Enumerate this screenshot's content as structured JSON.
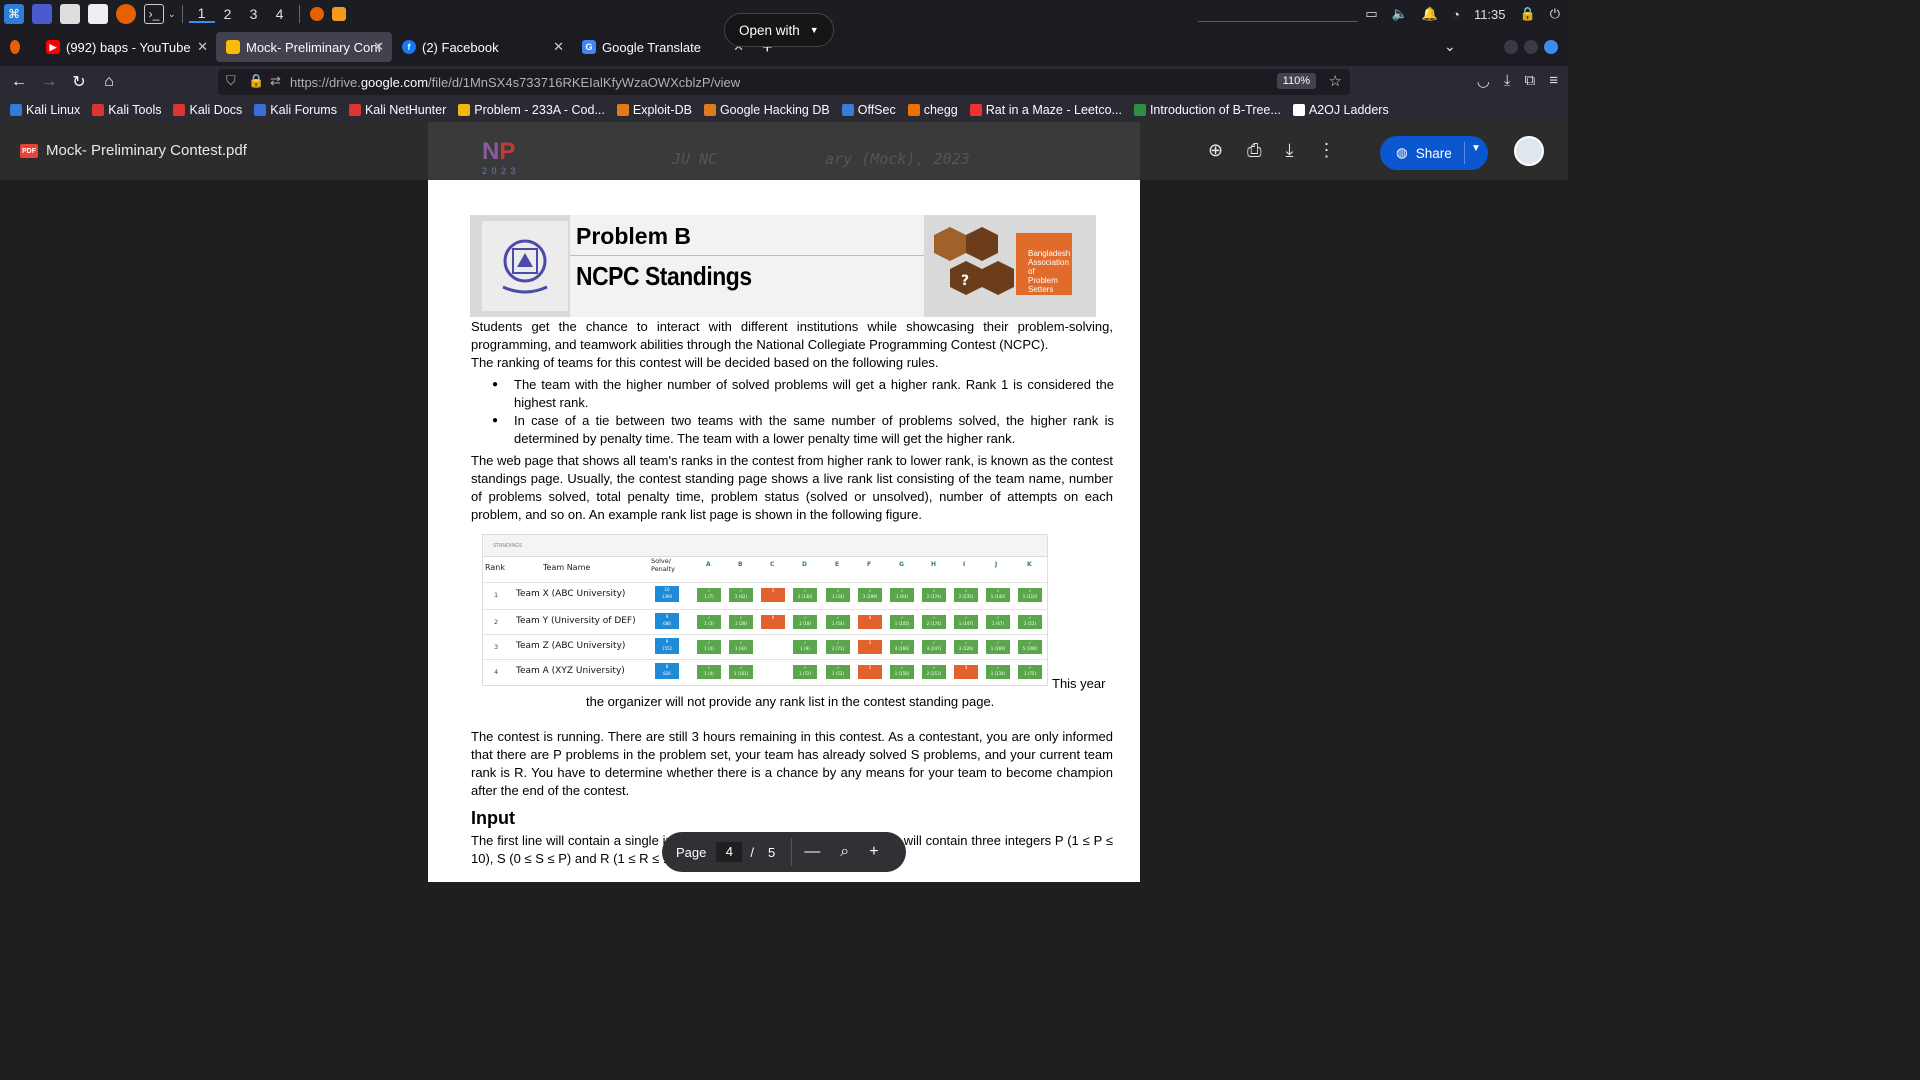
{
  "taskbar": {
    "workspaces": [
      "1",
      "2",
      "3",
      "4"
    ],
    "clock": "11:35"
  },
  "tabs": [
    {
      "label": "(992) baps - YouTube",
      "color": "#ff0000"
    },
    {
      "label": "Mock- Preliminary Conte",
      "color": "#fbbc04"
    },
    {
      "label": "(2) Facebook",
      "color": "#1877f2"
    },
    {
      "label": "Google Translate",
      "color": "#4285f4"
    }
  ],
  "nav": {
    "url_prefix": "https://drive.",
    "url_domain": "google.com",
    "url_rest": "/file/d/1MnSX4s733716RKEIalKfyWzaOWXcblzP/view",
    "zoom": "110%"
  },
  "bookmarks": [
    {
      "label": "Kali Linux",
      "color": "#2e7dd7"
    },
    {
      "label": "Kali Tools",
      "color": "#d33"
    },
    {
      "label": "Kali Docs",
      "color": "#d33"
    },
    {
      "label": "Kali Forums",
      "color": "#3b6fd8"
    },
    {
      "label": "Kali NetHunter",
      "color": "#d33"
    },
    {
      "label": "Problem - 233A - Cod...",
      "color": "#f2b705"
    },
    {
      "label": "Exploit-DB",
      "color": "#e07a1f"
    },
    {
      "label": "Google Hacking DB",
      "color": "#e07a1f"
    },
    {
      "label": "OffSec",
      "color": "#3a7bd5"
    },
    {
      "label": "chegg",
      "color": "#eb7100"
    },
    {
      "label": "Rat in a Maze - Leetco...",
      "color": "#e33"
    },
    {
      "label": "Introduction of B-Tree...",
      "color": "#2f8d46"
    },
    {
      "label": "A2OJ Ladders",
      "color": "#ffffff"
    }
  ],
  "drive": {
    "pdf_badge": "PDF",
    "filename": "Mock- Preliminary Contest.pdf",
    "open_with": "Open with",
    "share": "Share"
  },
  "page_header": {
    "title_left": "JU NC",
    "title_right": "ary (Mock), 2023",
    "logo_year": "2 0 2 3"
  },
  "problem": {
    "letter": "Problem B",
    "name": "NCPC Standings",
    "bap": [
      "Bangladesh",
      "Association",
      "of",
      "Problem",
      "Setters"
    ],
    "p1": "Students get the chance to interact with different institutions while showcasing their problem-solving, programming, and teamwork abilities through the National Collegiate Programming Contest (NCPC).",
    "p2": "The ranking of teams for this contest will be decided based on the following rules.",
    "b1": "The team with the higher number of solved problems will get a higher rank. Rank 1 is considered the highest rank.",
    "b2": "In case of a tie between two teams with the same number of problems solved, the higher rank is determined by penalty time. The team with a lower penalty time will get the higher rank.",
    "p3": "The web page that shows all team's ranks in the contest from higher rank to lower rank, is known as the contest standings page. Usually, the contest standing page shows a live rank list consisting of the team name, number of problems solved, total penalty time, problem status (solved or unsolved), number of attempts on each problem, and so on. An example rank list page is shown in the following figure.",
    "p4a": "This year",
    "p4b": "the organizer will not provide any rank list in the contest standing page.",
    "p5": "The contest is running. There are still 3 hours remaining in this contest. As a contestant, you are only informed that  there are P problems in the problem set, your team has already solved S problems, and your current team rank is R. You have to determine whether there is a chance by any means for your team to become champion after the end of the contest.",
    "input_heading": "Input",
    "p6": "The first line will contain a single integer T (1 ≤ T ≤ 18150). Each test case will contain three integers P (1 ≤ P ≤ 10), S (0 ≤ S ≤ P) and R (1 ≤ R ≤ 165)."
  },
  "standings": {
    "caption": "STANDINGS",
    "h_rank": "Rank",
    "h_team": "Team Name",
    "h_solve": "Solve/ Penalty",
    "cols": [
      "A",
      "B",
      "C",
      "D",
      "E",
      "F",
      "G",
      "H",
      "I",
      "J",
      "K"
    ],
    "rows": [
      {
        "rank": "1",
        "team": "Team X (ABC University)",
        "solve": "10",
        "penalty": "1394",
        "cells": [
          [
            "ok",
            "1 (7)"
          ],
          [
            "ok",
            "2 (62)"
          ],
          [
            "bad",
            "1"
          ],
          [
            "ok",
            "3 (130)"
          ],
          [
            "ok",
            "1 (34)"
          ],
          [
            "ok",
            "3 (299)"
          ],
          [
            "ok",
            "1 (63)"
          ],
          [
            "ok",
            "2 (174)"
          ],
          [
            "ok",
            "2 (235)"
          ],
          [
            "ok",
            "1 (140)"
          ],
          [
            "ok",
            "1 (110)"
          ]
        ]
      },
      {
        "rank": "2",
        "team": "Team Y (University of DEF)",
        "solve": "9",
        "penalty": "688",
        "cells": [
          [
            "ok",
            "1 (3)"
          ],
          [
            "ok",
            "1 (28)"
          ],
          [
            "bad",
            "9"
          ],
          [
            "ok",
            "1 (18)"
          ],
          [
            "ok",
            "1 (54)"
          ],
          [
            "bad",
            "4"
          ],
          [
            "ok",
            "1 (105)"
          ],
          [
            "ok",
            "2 (174)"
          ],
          [
            "ok",
            "1 (147)"
          ],
          [
            "ok",
            "1 (67)"
          ],
          [
            "ok",
            "2 (52)"
          ]
        ]
      },
      {
        "rank": "3",
        "team": "Team Z (ABC University)",
        "solve": "9",
        "penalty": "1552",
        "cells": [
          [
            "ok",
            "1 (4)"
          ],
          [
            "ok",
            "1 (92)"
          ],
          [
            "",
            ""
          ],
          [
            "ok",
            "1 (9)"
          ],
          [
            "ok",
            "2 (71)"
          ],
          [
            "bad",
            "1"
          ],
          [
            "ok",
            "4 (166)"
          ],
          [
            "ok",
            "4 (247)"
          ],
          [
            "ok",
            "3 (226)"
          ],
          [
            "ok",
            "1 (169)"
          ],
          [
            "ok",
            "5 (308)"
          ]
        ]
      },
      {
        "rank": "4",
        "team": "Team A (XYZ University)",
        "solve": "8",
        "penalty": "826",
        "cells": [
          [
            "ok",
            "1 (4)"
          ],
          [
            "ok",
            "1 (101)"
          ],
          [
            "",
            ""
          ],
          [
            "ok",
            "1 (72)"
          ],
          [
            "ok",
            "1 (52)"
          ],
          [
            "bad",
            "1"
          ],
          [
            "ok",
            "1 (156)"
          ],
          [
            "ok",
            "2 (212)"
          ],
          [
            "bad",
            "3"
          ],
          [
            "ok",
            "1 (134)"
          ],
          [
            "ok",
            "1 (75)"
          ]
        ]
      }
    ]
  },
  "pdf_toolbar": {
    "page_label": "Page",
    "current": "4",
    "separator": "/",
    "total": "5"
  }
}
